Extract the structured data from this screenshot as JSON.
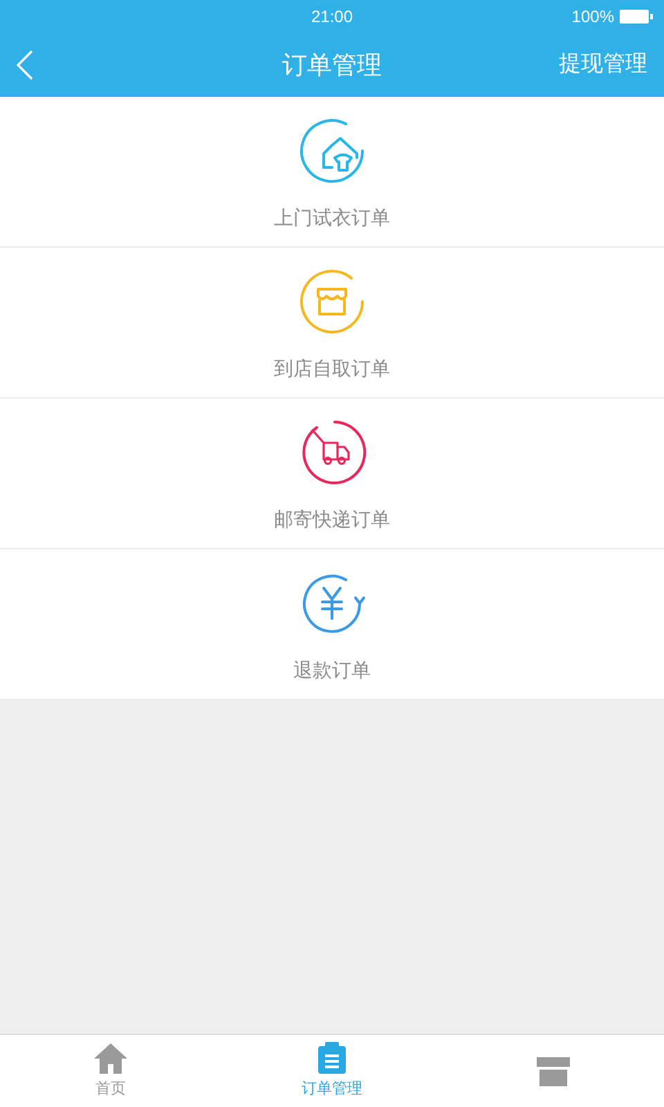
{
  "status_bar": {
    "time": "21:00",
    "battery": "100%"
  },
  "nav": {
    "title": "订单管理",
    "action": "提现管理"
  },
  "orders": [
    {
      "kind": "home",
      "color": "#29b6e8",
      "label": "上门试衣订单"
    },
    {
      "kind": "store",
      "color": "#f5b71c",
      "label": "到店自取订单"
    },
    {
      "kind": "truck",
      "color": "#e5295c",
      "label": "邮寄快递订单"
    },
    {
      "kind": "refund",
      "color": "#3a9ae6",
      "label": "退款订单"
    }
  ],
  "tab_bar": [
    {
      "kind": "home",
      "label": "首页",
      "selected": false
    },
    {
      "kind": "clipboard",
      "label": "订单管理",
      "selected": true
    },
    {
      "kind": "store",
      "selected": false
    }
  ]
}
